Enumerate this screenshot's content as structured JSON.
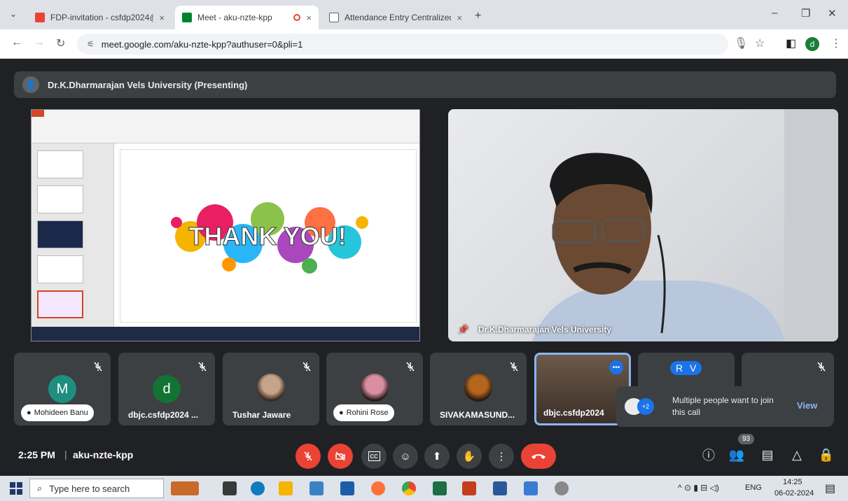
{
  "browser": {
    "tabs": [
      {
        "title": "FDP-invitation - csfdp2024@g",
        "close": "×"
      },
      {
        "title": "Meet - aku-nzte-kpp",
        "close": "×"
      },
      {
        "title": "Attendance Entry Centralized",
        "close": "×"
      }
    ],
    "new_tab": "+",
    "url": "meet.google.com/aku-nzte-kpp?authuser=0&pli=1",
    "profile_initial": "d"
  },
  "meet": {
    "presenting_label": "Dr.K.Dharmarajan Vels University (Presenting)",
    "slide_text": "THANK YOU!",
    "camera_name": "Dr.K.Dharmarajan Vels University",
    "participants": [
      {
        "name": "Mohideen Banu",
        "initial": "M",
        "color": "#1e8e7e",
        "style": "pill"
      },
      {
        "name": "dbjc.csfdp2024 ...",
        "initial": "d",
        "color": "#137333",
        "style": "plain"
      },
      {
        "name": "Tushar Jaware",
        "initial": "",
        "color": "#c5a48a",
        "style": "plain"
      },
      {
        "name": "Rohini Rose",
        "initial": "",
        "color": "#d98fa0",
        "style": "pill"
      },
      {
        "name": "SIVAKAMASUND...",
        "initial": "",
        "color": "#b5651d",
        "style": "plain"
      },
      {
        "name": "dbjc.csfdp2024",
        "initial": "",
        "color": "#7a5c4c",
        "style": "plain"
      },
      {
        "name": "",
        "initial": "R V",
        "color": "#1a73e8",
        "style": "plain"
      }
    ],
    "popup": {
      "text": "Multiple people want to join this call",
      "badge": "+2",
      "action": "View"
    },
    "time": "2:25 PM",
    "separator": "|",
    "meeting_code": "aku-nzte-kpp",
    "participant_count": "93"
  },
  "taskbar": {
    "search_placeholder": "Type here to search",
    "language": "ENG",
    "clock_time": "14:25",
    "clock_date": "06-02-2024"
  }
}
